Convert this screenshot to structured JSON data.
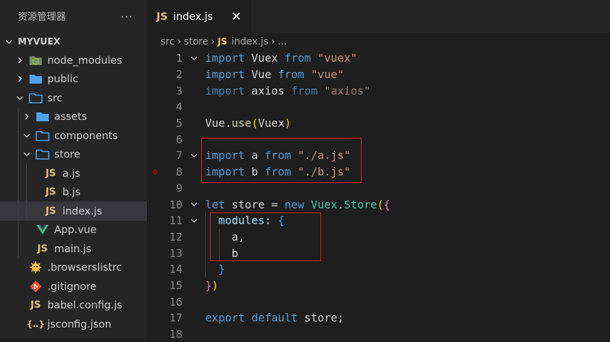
{
  "explorer": {
    "title": "资源管理器",
    "more_icon": "···",
    "root_label": "MYVUEX",
    "items": [
      {
        "label": "node_modules",
        "kind": "folder",
        "icon": "node-modules-folder-icon",
        "expanded": false,
        "depth": 1
      },
      {
        "label": "public",
        "kind": "folder",
        "icon": "folder-icon",
        "expanded": false,
        "depth": 1
      },
      {
        "label": "src",
        "kind": "folder",
        "icon": "folder-open-icon",
        "expanded": true,
        "depth": 1
      },
      {
        "label": "assets",
        "kind": "folder",
        "icon": "folder-icon",
        "expanded": false,
        "depth": 2
      },
      {
        "label": "components",
        "kind": "folder",
        "icon": "folder-open-icon",
        "expanded": true,
        "depth": 2
      },
      {
        "label": "store",
        "kind": "folder",
        "icon": "folder-open-icon",
        "expanded": true,
        "depth": 2
      },
      {
        "label": "a.js",
        "kind": "file",
        "icon": "js-icon",
        "depth": 3
      },
      {
        "label": "b.js",
        "kind": "file",
        "icon": "js-icon",
        "depth": 3
      },
      {
        "label": "index.js",
        "kind": "file",
        "icon": "js-icon",
        "depth": 3,
        "selected": true
      },
      {
        "label": "App.vue",
        "kind": "file",
        "icon": "vue-icon",
        "depth": 2
      },
      {
        "label": "main.js",
        "kind": "file",
        "icon": "js-icon",
        "depth": 2
      },
      {
        "label": ".browserslistrc",
        "kind": "file",
        "icon": "browserslist-icon",
        "depth": 1
      },
      {
        "label": ".gitignore",
        "kind": "file",
        "icon": "git-icon",
        "depth": 1
      },
      {
        "label": "babel.config.js",
        "kind": "file",
        "icon": "js-icon",
        "depth": 1
      },
      {
        "label": "jsconfig.json",
        "kind": "file",
        "icon": "json-icon",
        "depth": 1
      }
    ]
  },
  "tab": {
    "label": "index.js",
    "icon_text": "JS",
    "close": "✕"
  },
  "breadcrumb": {
    "parts": [
      "src",
      "store"
    ],
    "file": "index.js",
    "tail": "...",
    "icon_text": "JS"
  },
  "colors": {
    "keyword": "#569cd6",
    "string": "#ce9178",
    "variable": "#9cdcfe",
    "class": "#4ec9b0",
    "function": "#dcdcaa",
    "highlight_box": "#e0202a",
    "js_icon": "#e5c07b",
    "folder": "#4da3f0",
    "vue": "#41b883"
  },
  "code": {
    "lines": [
      {
        "n": "1",
        "fold": true,
        "tokens": [
          [
            "kw",
            "import"
          ],
          [
            "p",
            " Vuex "
          ],
          [
            "kw",
            "from"
          ],
          [
            "p",
            " "
          ],
          [
            "str",
            "\"vuex\""
          ]
        ]
      },
      {
        "n": "2",
        "tokens": [
          [
            "kw",
            "import"
          ],
          [
            "p",
            " Vue "
          ],
          [
            "kw",
            "from"
          ],
          [
            "p",
            " "
          ],
          [
            "str",
            "\"vue\""
          ]
        ]
      },
      {
        "n": "3",
        "tokens": [
          [
            "kwd",
            "import"
          ],
          [
            "p",
            " axios "
          ],
          [
            "kwd",
            "from"
          ],
          [
            "p",
            " "
          ],
          [
            "strd",
            "\"axios\""
          ]
        ]
      },
      {
        "n": "4",
        "tokens": []
      },
      {
        "n": "5",
        "tokens": [
          [
            "p",
            "Vue."
          ],
          [
            "fn",
            "use"
          ],
          [
            "br1",
            "("
          ],
          [
            "p",
            "Vuex"
          ],
          [
            "br1",
            ")"
          ]
        ]
      },
      {
        "n": "6",
        "tokens": []
      },
      {
        "n": "7",
        "fold": true,
        "tokens": [
          [
            "kw",
            "import"
          ],
          [
            "p",
            " a "
          ],
          [
            "kw",
            "from"
          ],
          [
            "p",
            " "
          ],
          [
            "str",
            "\"./a.js\""
          ]
        ]
      },
      {
        "n": "8",
        "breakpoint": true,
        "tokens": [
          [
            "kw",
            "import"
          ],
          [
            "p",
            " b "
          ],
          [
            "kw",
            "from"
          ],
          [
            "p",
            " "
          ],
          [
            "str",
            "\"./b.js\""
          ]
        ]
      },
      {
        "n": "9",
        "tokens": []
      },
      {
        "n": "10",
        "fold": true,
        "tokens": [
          [
            "kw",
            "let"
          ],
          [
            "p",
            " store = "
          ],
          [
            "kw",
            "new"
          ],
          [
            "p",
            " "
          ],
          [
            "cls",
            "Vuex"
          ],
          [
            "p",
            "."
          ],
          [
            "cls",
            "Store"
          ],
          [
            "br1",
            "("
          ],
          [
            "br2",
            "{"
          ]
        ]
      },
      {
        "n": "11",
        "fold": true,
        "tokens": [
          [
            "p",
            "  "
          ],
          [
            "var",
            "modules"
          ],
          [
            "p",
            ": "
          ],
          [
            "br3",
            "{"
          ]
        ]
      },
      {
        "n": "12",
        "tokens": [
          [
            "p",
            "    a,"
          ]
        ]
      },
      {
        "n": "13",
        "tokens": [
          [
            "p",
            "    b"
          ]
        ]
      },
      {
        "n": "14",
        "tokens": [
          [
            "p",
            "  "
          ],
          [
            "br3",
            "}"
          ]
        ]
      },
      {
        "n": "15",
        "tokens": [
          [
            "br2",
            "}"
          ],
          [
            "br1",
            ")"
          ]
        ]
      },
      {
        "n": "16",
        "tokens": []
      },
      {
        "n": "17",
        "tokens": [
          [
            "kw",
            "export"
          ],
          [
            "p",
            " "
          ],
          [
            "kw",
            "default"
          ],
          [
            "p",
            " store;"
          ]
        ]
      },
      {
        "n": "18",
        "tokens": []
      }
    ]
  }
}
